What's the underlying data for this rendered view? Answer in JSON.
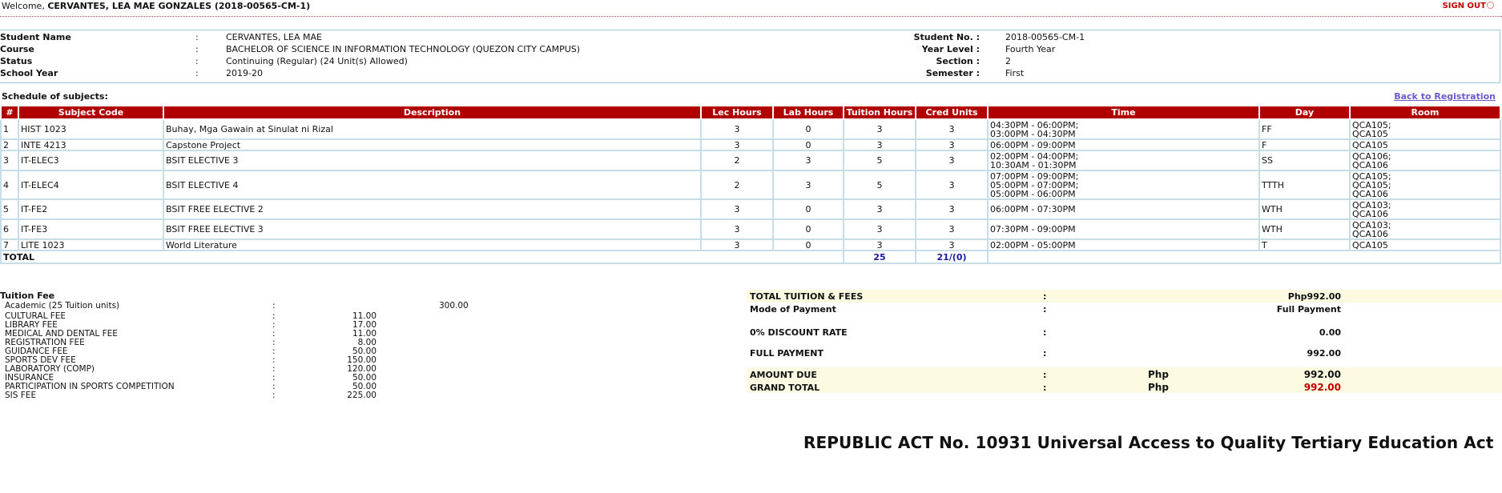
{
  "header": {
    "welcome_prefix": "Welcome,",
    "welcome_name": "CERVANTES, LEA MAE GONZALES (2018-00565-CM-1)",
    "signout_label": "SIGN OUT"
  },
  "student": {
    "name_label": "Student Name",
    "name": "CERVANTES, LEA MAE",
    "course_label": "Course",
    "course": "BACHELOR OF SCIENCE IN INFORMATION TECHNOLOGY (QUEZON CITY CAMPUS)",
    "status_label": "Status",
    "status": "Continuing (Regular) (24 Unit(s) Allowed)",
    "school_year_label": "School Year",
    "school_year": "2019-20",
    "student_no_label": "Student No. :",
    "student_no": "2018-00565-CM-1",
    "year_level_label": "Year Level :",
    "year_level": "Fourth Year",
    "section_label": "Section :",
    "section": "2",
    "semester_label": "Semester :",
    "semester": "First",
    "colon": ":"
  },
  "schedule": {
    "title": "Schedule of subjects:",
    "back_link": "Back to Registration",
    "columns": [
      "#",
      "Subject Code",
      "Description",
      "Lec Hours",
      "Lab Hours",
      "Tuition Hours",
      "Cred Units",
      "Time",
      "Day",
      "Room"
    ],
    "rows": [
      {
        "no": "1",
        "code": "HIST 1023",
        "desc": "Buhay, Mga Gawain at Sinulat ni Rizal",
        "lec": "3",
        "lab": "0",
        "tuition": "3",
        "cred": "3",
        "time": [
          "04:30PM - 06:00PM;",
          "03:00PM - 04:30PM"
        ],
        "day": "FF",
        "room": [
          "QCA105;",
          "QCA105"
        ]
      },
      {
        "no": "2",
        "code": "INTE 4213",
        "desc": "Capstone Project",
        "lec": "3",
        "lab": "0",
        "tuition": "3",
        "cred": "3",
        "time": [
          "06:00PM - 09:00PM"
        ],
        "day": "F",
        "room": [
          "QCA105"
        ]
      },
      {
        "no": "3",
        "code": "IT-ELEC3",
        "desc": "BSIT ELECTIVE 3",
        "lec": "2",
        "lab": "3",
        "tuition": "5",
        "cred": "3",
        "time": [
          "02:00PM - 04:00PM;",
          "10:30AM - 01:30PM"
        ],
        "day": "SS",
        "room": [
          "QCA106;",
          "QCA106"
        ]
      },
      {
        "no": "4",
        "code": "IT-ELEC4",
        "desc": "BSIT ELECTIVE 4",
        "lec": "2",
        "lab": "3",
        "tuition": "5",
        "cred": "3",
        "time": [
          "07:00PM - 09:00PM;",
          "05:00PM - 07:00PM;",
          "05:00PM - 06:00PM"
        ],
        "day": "TTTH",
        "room": [
          "QCA105;",
          "QCA105;",
          "QCA106"
        ]
      },
      {
        "no": "5",
        "code": "IT-FE2",
        "desc": "BSIT FREE ELECTIVE 2",
        "lec": "3",
        "lab": "0",
        "tuition": "3",
        "cred": "3",
        "time": [
          "06:00PM - 07:30PM"
        ],
        "day": "WTH",
        "room": [
          "QCA103;",
          "QCA106"
        ]
      },
      {
        "no": "6",
        "code": "IT-FE3",
        "desc": "BSIT FREE ELECTIVE 3",
        "lec": "3",
        "lab": "0",
        "tuition": "3",
        "cred": "3",
        "time": [
          "07:30PM - 09:00PM"
        ],
        "day": "WTH",
        "room": [
          "QCA103;",
          "QCA106"
        ]
      },
      {
        "no": "7",
        "code": "LITE 1023",
        "desc": "World Literature",
        "lec": "3",
        "lab": "0",
        "tuition": "3",
        "cred": "3",
        "time": [
          "02:00PM - 05:00PM"
        ],
        "day": "T",
        "room": [
          "QCA105"
        ]
      }
    ],
    "total_label": "TOTAL",
    "total_tuition": "25",
    "total_cred": "21/(0)"
  },
  "fees": {
    "title": "Tuition Fee",
    "academic_label": "Academic (25 Tuition units)",
    "academic_value": "300.00",
    "colon": ":",
    "items": [
      {
        "label": "CULTURAL FEE",
        "value": "11.00"
      },
      {
        "label": "LIBRARY FEE",
        "value": "17.00"
      },
      {
        "label": "MEDICAL AND DENTAL FEE",
        "value": "11.00"
      },
      {
        "label": "REGISTRATION FEE",
        "value": "8.00"
      },
      {
        "label": "GUIDANCE FEE",
        "value": "50.00"
      },
      {
        "label": "SPORTS DEV FEE",
        "value": "150.00"
      },
      {
        "label": "LABORATORY (COMP)",
        "value": "120.00"
      },
      {
        "label": "INSURANCE",
        "value": "50.00"
      },
      {
        "label": "PARTICIPATION IN SPORTS COMPETITION",
        "value": "50.00"
      },
      {
        "label": "SIS FEE",
        "value": "225.00"
      }
    ]
  },
  "summary": {
    "total_label": "TOTAL TUITION & FEES",
    "total_value": "Php992.00",
    "mode_label": "Mode of Payment",
    "mode_value": "Full Payment",
    "discount_label": "0% DISCOUNT RATE",
    "discount_value": "0.00",
    "full_label": "FULL PAYMENT",
    "full_value": "992.00",
    "amount_due_label": "AMOUNT DUE",
    "currency": "Php",
    "amount_due_value": "992.00",
    "grand_total_label": "GRAND TOTAL",
    "grand_total_value": "992.00",
    "colon": ":"
  },
  "footer": {
    "republic_act": "REPUBLIC ACT No. 10931 Universal Access to Quality Tertiary Education Act"
  },
  "colors": {
    "header_red": "#b00000",
    "border_blue": "#c9dde8",
    "band": "#fcfbe2",
    "link": "#6a5acd",
    "total_blue": "#1a1aa0"
  }
}
